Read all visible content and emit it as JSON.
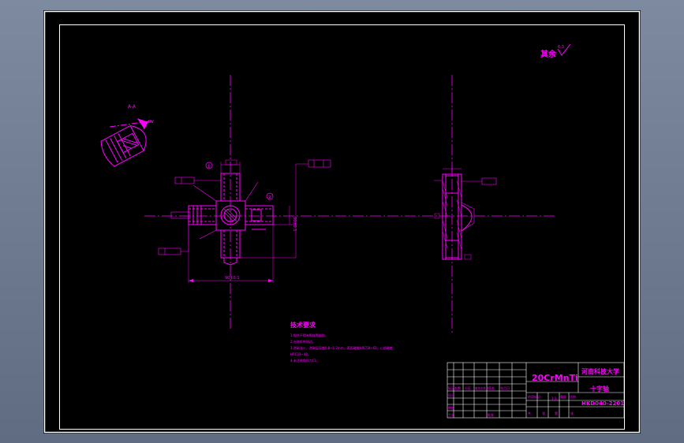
{
  "drawing": {
    "surface_finish_note": "其余",
    "surface_roughness_value": "6.3",
    "section_view_label": "A-A",
    "callout_1": "①",
    "callout_2": "②",
    "dim_total_length": "90±0.1",
    "dim_height": "90±0.1"
  },
  "technical_requirements": {
    "title": "技术要求",
    "items": [
      "1.锻件不得有裂纹等缺陷。",
      "2.去除毛刺锐边。",
      "3.渗碳淬火，渗碳层深度0.8~1.2mm，表面硬度HRC58~62，心部硬度",
      "HRC33~48。",
      "4.未注倒角均为C1。"
    ]
  },
  "title_block": {
    "material": "20CrMnTi",
    "organization": "河南科技大学",
    "part_name": "十字轴",
    "drawing_number": "HKD040-2201",
    "scale": "1:1",
    "row_labels": [
      "标记",
      "处数",
      "分区",
      "更改文件号",
      "签名",
      "年月日"
    ],
    "side_labels": [
      "设计",
      "审核",
      "工艺"
    ],
    "bottom_labels": [
      "批准"
    ],
    "stage_labels": [
      "阶段标记",
      "重量",
      "比例"
    ],
    "sheet_labels": [
      "共",
      "张",
      "第",
      "张"
    ]
  },
  "colors": {
    "background": "#000000",
    "drawing": "#ff00ff",
    "frame": "#ffffff",
    "centerline": "#ff00ff"
  }
}
